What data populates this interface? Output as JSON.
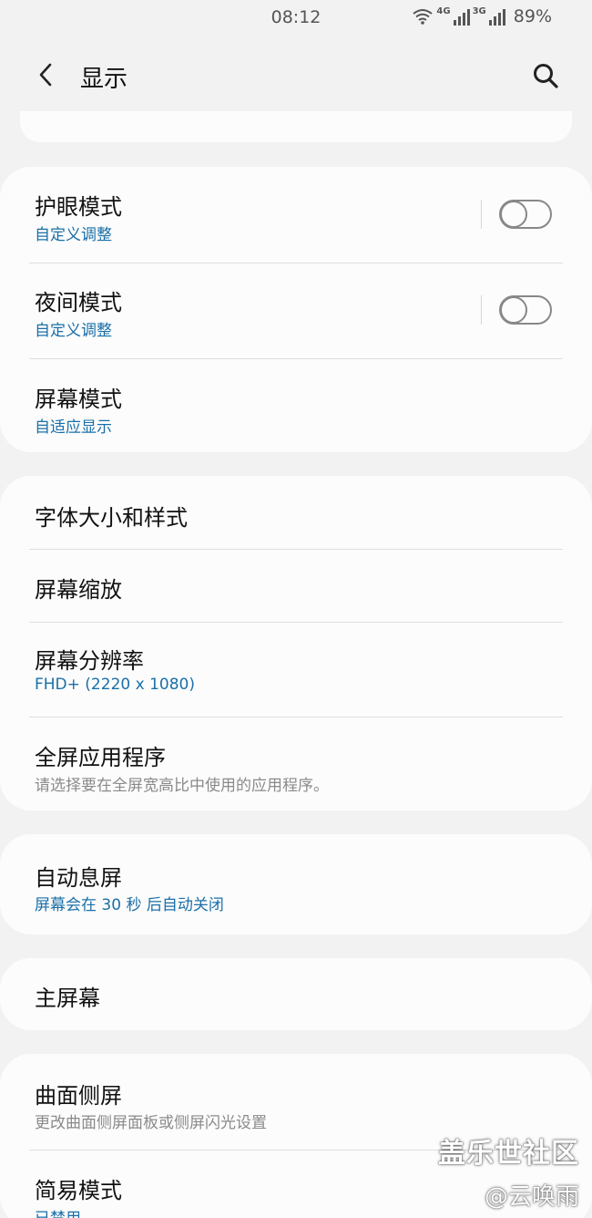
{
  "status_bar": {
    "time": "08:12",
    "network_1": "4G",
    "network_2": "3G",
    "battery": "89%"
  },
  "header": {
    "title": "显示",
    "back_icon": "chevron-left-icon",
    "search_icon": "search-icon"
  },
  "group_1": {
    "eye_comfort": {
      "title": "护眼模式",
      "subtitle": "自定义调整",
      "enabled": false
    },
    "night_mode": {
      "title": "夜间模式",
      "subtitle": "自定义调整",
      "enabled": false
    },
    "screen_mode": {
      "title": "屏幕模式",
      "subtitle": "自适应显示"
    }
  },
  "group_2": {
    "font": {
      "title": "字体大小和样式"
    },
    "zoom": {
      "title": "屏幕缩放"
    },
    "resolution": {
      "title": "屏幕分辨率",
      "subtitle": "FHD+ (2220 x 1080)"
    },
    "fullscreen_apps": {
      "title": "全屏应用程序",
      "subtitle": "请选择要在全屏宽高比中使用的应用程序。"
    }
  },
  "group_3": {
    "screen_timeout": {
      "title": "自动息屏",
      "subtitle": "屏幕会在 30 秒 后自动关闭"
    }
  },
  "group_4": {
    "home_screen": {
      "title": "主屏幕"
    }
  },
  "group_5": {
    "edge_screen": {
      "title": "曲面侧屏",
      "subtitle": "更改曲面侧屏面板或侧屏闪光设置"
    },
    "easy_mode": {
      "title": "简易模式",
      "subtitle": "已禁用"
    }
  },
  "watermark": {
    "line1": "盖乐世社区",
    "line2": "@云唤雨"
  },
  "colors": {
    "background": "#f2f2f2",
    "card": "#fcfcfc",
    "accent_blue": "#1a6fa8",
    "secondary_gray": "#8a8a8a"
  }
}
